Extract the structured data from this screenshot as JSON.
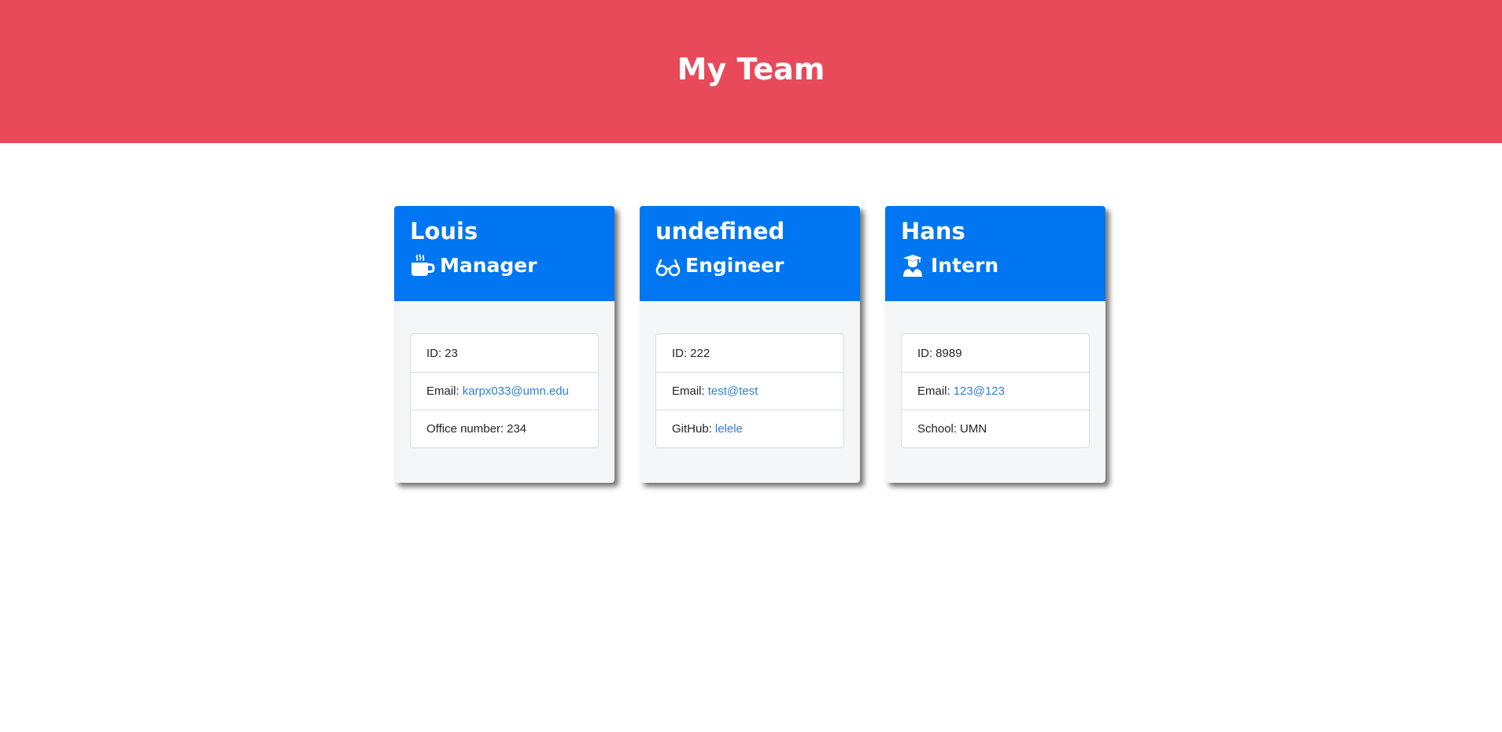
{
  "header": {
    "title": "My Team"
  },
  "colors": {
    "header_bg": "#e84a5a",
    "card_header_bg": "#0076f2",
    "link": "#2f7fd6"
  },
  "team": [
    {
      "name": "Louis",
      "role": "Manager",
      "role_icon": "mug-icon",
      "id_label": "ID:",
      "id": "23",
      "email_label": "Email:",
      "email": "karpx033@umn.edu",
      "extra_label": "Office number:",
      "extra_value": "234"
    },
    {
      "name": "undefined",
      "role": "Engineer",
      "role_icon": "glasses-icon",
      "id_label": "ID:",
      "id": "222",
      "email_label": "Email:",
      "email": "test@test",
      "extra_label": "GitHub:",
      "extra_value": "lelele"
    },
    {
      "name": "Hans",
      "role": "Intern",
      "role_icon": "graduate-icon",
      "id_label": "ID:",
      "id": "8989",
      "email_label": "Email:",
      "email": "123@123",
      "extra_label": "School:",
      "extra_value": "UMN"
    }
  ]
}
